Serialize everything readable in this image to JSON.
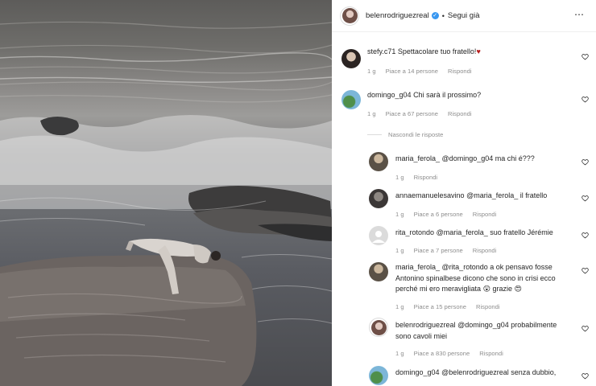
{
  "post": {
    "username": "belenrodriguezreal",
    "separator": "•",
    "follow_label": "Segui già",
    "more_icon": "more-icon"
  },
  "comments": [
    {
      "user": "stefy.c71",
      "text": "Spettacolare tuo fratello!",
      "emoji": "♥",
      "time": "1 g",
      "likes": "Piace a 14 persone",
      "reply": "Rispondi"
    },
    {
      "user": "domingo_g04",
      "text": "Chi sarà il prossimo?",
      "time": "1 g",
      "likes": "Piace a 67 persone",
      "reply": "Rispondi"
    }
  ],
  "hide_replies_label": "Nascondi le risposte",
  "replies": [
    {
      "user": "maria_ferola_",
      "text": "@domingo_g04 ma chi é???",
      "time": "1 g",
      "likes": "",
      "reply": "Rispondi"
    },
    {
      "user": "annaemanuelesavino",
      "text": "@maria_ferola_ il fratello",
      "time": "1 g",
      "likes": "Piace a 6 persone",
      "reply": "Rispondi"
    },
    {
      "user": "rita_rotondo",
      "text": "@maria_ferola_ suo fratello Jérémie",
      "time": "1 g",
      "likes": "Piace a 7 persone",
      "reply": "Rispondi"
    },
    {
      "user": "maria_ferola_",
      "line1": "@rita_rotondo a ok pensavo fosse",
      "line2": "Antonino spinalbese dicono che sono in crisi ecco",
      "line3": "perché mi ero meravigliata",
      "emoji1": "😲",
      "mid": "grazie",
      "emoji2": "😍",
      "time": "1 g",
      "likes": "Piace a 15 persone",
      "reply": "Rispondi"
    },
    {
      "user": "belenrodriguezreal",
      "line1": "@domingo_g04 probabilmente",
      "line2": "sono cavoli miei",
      "time": "1 g",
      "likes": "Piace a 830 persone",
      "reply": "Rispondi"
    },
    {
      "user": "domingo_g04",
      "text": "@belenrodriguezreal senza dubbio,",
      "time": "",
      "likes": "",
      "reply": ""
    }
  ]
}
